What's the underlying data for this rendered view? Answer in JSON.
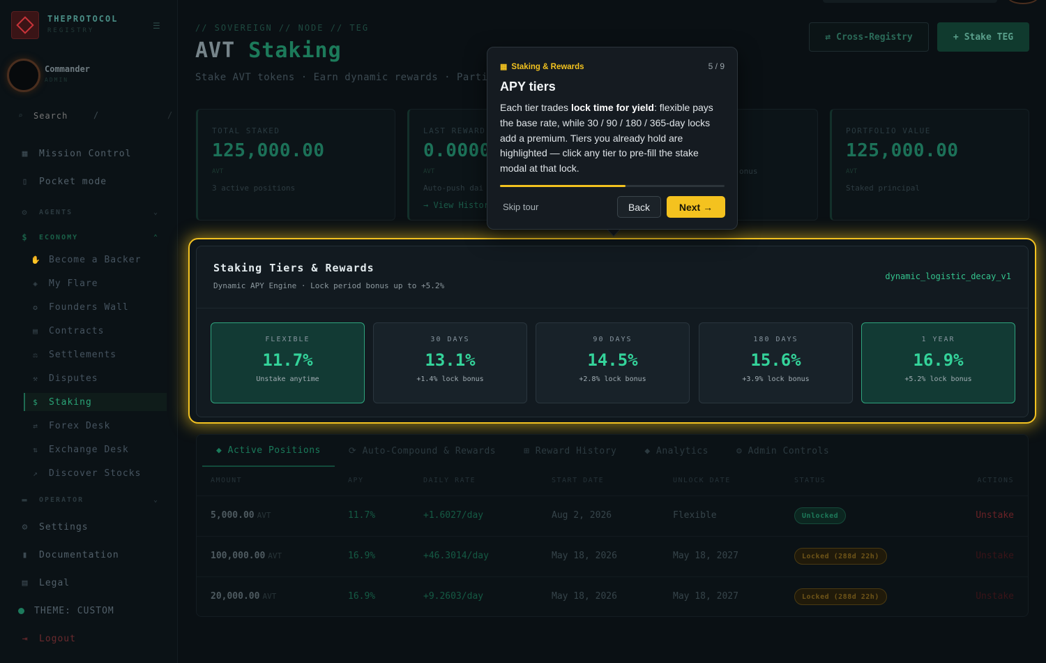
{
  "brand": {
    "name": "THEPROTOCOL",
    "sub": "REGISTRY"
  },
  "user": {
    "name": "Commander",
    "role": "ADMIN"
  },
  "search": {
    "placeholder": "Search",
    "shortcut": "/",
    "shortcut2": "/"
  },
  "nav": {
    "mission_control": "Mission Control",
    "pocket_mode": "Pocket mode",
    "agents": "AGENTS",
    "economy": "ECONOMY",
    "economy_items": [
      "Become a Backer",
      "My Flare",
      "Founders Wall",
      "Contracts",
      "Settlements",
      "Disputes",
      "Staking",
      "Forex Desk",
      "Exchange Desk",
      "Discover Stocks"
    ],
    "operator": "OPERATOR",
    "settings": "Settings",
    "documentation": "Documentation",
    "legal": "Legal",
    "theme": "THEME: CUSTOM",
    "logout": "Logout"
  },
  "header": {
    "breadcrumb": "// SOVEREIGN // NODE // TEG",
    "title_prefix": "AVT",
    "title_accent": "Staking",
    "subtitle": "Stake AVT tokens · Earn dynamic rewards · Partici",
    "cross_registry": "Cross-Registry",
    "stake_button": "Stake TEG"
  },
  "stats": {
    "total_staked": {
      "label": "TOTAL STAKED",
      "value": "125,000.00",
      "unit": "AVT",
      "note": "3 active positions"
    },
    "last_reward": {
      "label": "LAST REWARD",
      "value": "0.0000",
      "unit": "AVT",
      "note": "Auto-push dai",
      "link": "→ View Histor"
    },
    "third": {
      "note": "onus"
    },
    "portfolio": {
      "label": "PORTFOLIO VALUE",
      "value": "125,000.00",
      "unit": "AVT",
      "note": "Staked principal"
    }
  },
  "tiers": {
    "title": "Staking Tiers & Rewards",
    "subtitle": "Dynamic APY Engine · Lock period bonus up to +5.2%",
    "engine": "dynamic_logistic_decay_v1",
    "items": [
      {
        "name": "FLEXIBLE",
        "apy": "11.7%",
        "bonus": "Unstake anytime",
        "held": true
      },
      {
        "name": "30 DAYS",
        "apy": "13.1%",
        "bonus": "+1.4% lock bonus",
        "held": false
      },
      {
        "name": "90 DAYS",
        "apy": "14.5%",
        "bonus": "+2.8% lock bonus",
        "held": false
      },
      {
        "name": "180 DAYS",
        "apy": "15.6%",
        "bonus": "+3.9% lock bonus",
        "held": false
      },
      {
        "name": "1 YEAR",
        "apy": "16.9%",
        "bonus": "+5.2% lock bonus",
        "held": true
      }
    ]
  },
  "tabs": [
    "◆ Active Positions",
    "⟳ Auto-Compound & Rewards",
    "⊞ Reward History",
    "◆ Analytics",
    "⚙ Admin Controls"
  ],
  "table": {
    "headers": [
      "AMOUNT",
      "APY",
      "DAILY RATE",
      "START DATE",
      "UNLOCK DATE",
      "STATUS",
      "ACTIONS"
    ],
    "rows": [
      {
        "amount": "5,000.00",
        "unit": "AVT",
        "apy": "11.7%",
        "daily": "+1.6027/day",
        "start": "Aug 2, 2026",
        "unlock": "Flexible",
        "status": "Unlocked",
        "action": "Unstake"
      },
      {
        "amount": "100,000.00",
        "unit": "AVT",
        "apy": "16.9%",
        "daily": "+46.3014/day",
        "start": "May 18, 2026",
        "unlock": "May 18, 2027",
        "status": "Locked (288d 22h)",
        "action": "Unstake"
      },
      {
        "amount": "20,000.00",
        "unit": "AVT",
        "apy": "16.9%",
        "daily": "+9.2603/day",
        "start": "May 18, 2026",
        "unlock": "May 18, 2027",
        "status": "Locked (288d 22h)",
        "action": "Unstake"
      }
    ]
  },
  "tour": {
    "category": "Staking & Rewards",
    "step": "5 / 9",
    "progress": 0.56,
    "title": "APY tiers",
    "body_a": "Each tier trades ",
    "body_b": "lock time for yield",
    "body_c": ": flexible pays the base rate, while 30 / 90 / 180 / 365-day locks add a premium. Tiers you already hold are highlighted — click any tier to pre-fill the stake modal at that lock.",
    "skip": "Skip tour",
    "back": "Back",
    "next": "Next →"
  },
  "colors": {
    "accent": "#34d39a",
    "highlight": "#f3c221",
    "danger": "#c8343a"
  }
}
